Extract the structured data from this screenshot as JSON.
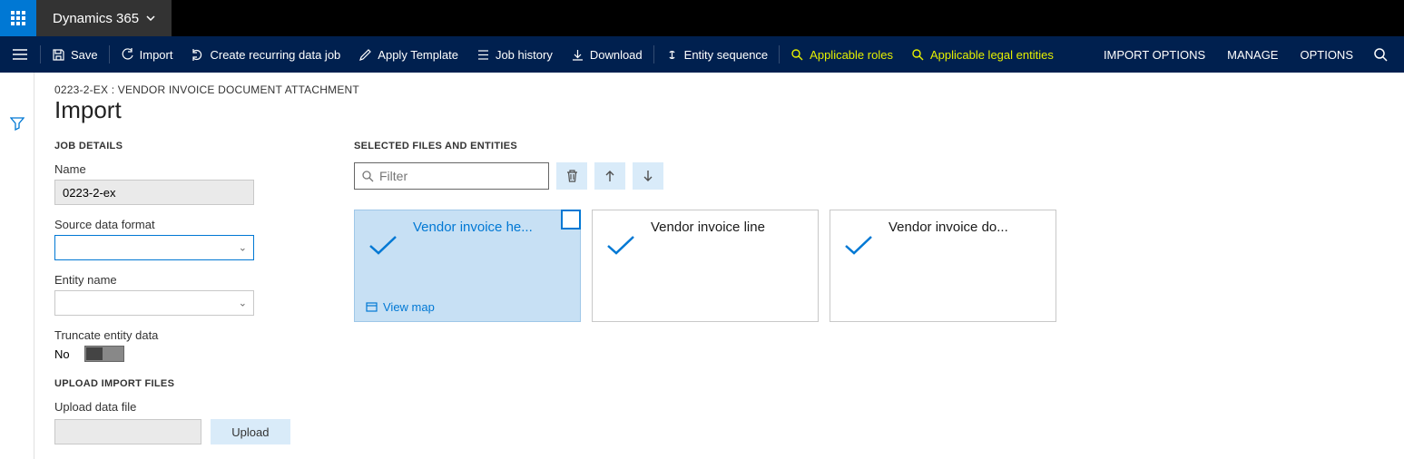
{
  "brand": "Dynamics 365",
  "commands": {
    "save": "Save",
    "import": "Import",
    "recurring": "Create recurring data job",
    "applyTemplate": "Apply Template",
    "jobHistory": "Job history",
    "download": "Download",
    "entitySequence": "Entity sequence",
    "applicableRoles": "Applicable roles",
    "applicableLegal": "Applicable legal entities",
    "importOptions": "IMPORT OPTIONS",
    "manage": "MANAGE",
    "options": "OPTIONS"
  },
  "breadcrumb": "0223-2-EX : VENDOR INVOICE DOCUMENT ATTACHMENT",
  "pageTitle": "Import",
  "sections": {
    "jobDetails": "JOB DETAILS",
    "selectedFiles": "SELECTED FILES AND ENTITIES",
    "uploadImport": "UPLOAD IMPORT FILES"
  },
  "fields": {
    "nameLabel": "Name",
    "nameValue": "0223-2-ex",
    "sourceFormatLabel": "Source data format",
    "sourceFormatValue": "",
    "entityNameLabel": "Entity name",
    "entityNameValue": "",
    "truncateLabel": "Truncate entity data",
    "truncateValue": "No",
    "uploadLabel": "Upload data file",
    "uploadBtn": "Upload"
  },
  "filterPlaceholder": "Filter",
  "entities": [
    {
      "title": "Vendor invoice he...",
      "selected": true,
      "viewMap": "View map"
    },
    {
      "title": "Vendor invoice line",
      "selected": false
    },
    {
      "title": "Vendor invoice do...",
      "selected": false
    }
  ]
}
